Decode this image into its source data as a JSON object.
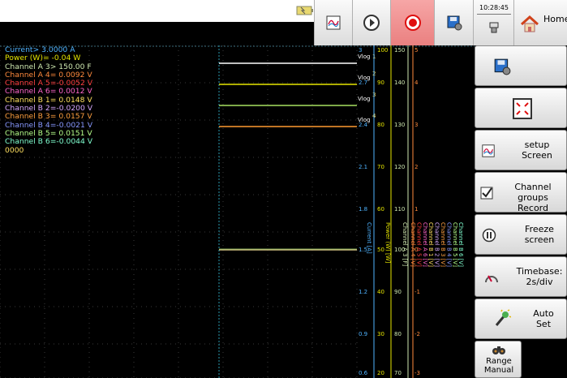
{
  "topbar": {
    "clock": "10:28:45",
    "home_label": "Home"
  },
  "readouts": [
    {
      "text": "Current> 3.0000 A",
      "color": "#4fb3ff"
    },
    {
      "text": "Power (W)= -0.04 W",
      "color": "#e6e600"
    },
    {
      "text": "Channel A 3> 150.00 F",
      "color": "#cfe8b0"
    },
    {
      "text": "Channel A 4= 0.0092 V",
      "color": "#ff8a3d"
    },
    {
      "text": "Channel A 5=-0.0052 V",
      "color": "#ff4040"
    },
    {
      "text": "Channel A 6= 0.0012 V",
      "color": "#ff66cc"
    },
    {
      "text": "Channel B 1= 0.0148 V",
      "color": "#ffe060"
    },
    {
      "text": "Channel B 2=-0.0200 V",
      "color": "#d6a8ff"
    },
    {
      "text": "Channel B 3= 0.0157 V",
      "color": "#ffa040"
    },
    {
      "text": "Channel B 4=-0.0021 V",
      "color": "#8899ff"
    },
    {
      "text": "Channel B 5= 0.0151 V",
      "color": "#b6ff8a"
    },
    {
      "text": "Channel B 6=-0.0044 V",
      "color": "#80ffd0"
    },
    {
      "text": "0000",
      "color": "#ffe060"
    }
  ],
  "vlog_labels": [
    {
      "num": "1",
      "text": "Vlog"
    },
    {
      "num": "2",
      "text": "Vlog"
    },
    {
      "num": "3",
      "text": "Vlog"
    },
    {
      "num": "4",
      "text": "Vlog"
    }
  ],
  "scales": {
    "current": [
      "3",
      "2.7",
      "2.4",
      "2.1",
      "1.8",
      "1.5",
      "1.2",
      "0.9",
      "0.6"
    ],
    "power": [
      "100",
      "90",
      "80",
      "70",
      "60",
      "50",
      "40",
      "30",
      "20"
    ],
    "chA3": [
      "150",
      "140",
      "130",
      "120",
      "110",
      "100",
      "90",
      "80",
      "70"
    ],
    "chA4": [
      "5",
      "4",
      "3",
      "2",
      "1",
      "0",
      "-1",
      "-2",
      "-3"
    ]
  },
  "axis_titles": {
    "current": "Current [A]",
    "power": "Power (W) [W]",
    "channels": [
      {
        "text": "Channel A 3 [F]",
        "color": "#cfe8b0"
      },
      {
        "text": "Channel A 4 [V]",
        "color": "#ff8a3d"
      },
      {
        "text": "Channel A 5 [V]",
        "color": "#ff4040"
      },
      {
        "text": "Channel A 6 [V]",
        "color": "#ff66cc"
      },
      {
        "text": "Channel B 1 [V]",
        "color": "#ffe060"
      },
      {
        "text": "Channel B 2 [V]",
        "color": "#d6a8ff"
      },
      {
        "text": "Channel B 3 [V]",
        "color": "#ffa040"
      },
      {
        "text": "Channel B 4 [V]",
        "color": "#8899ff"
      },
      {
        "text": "Channel B 5 [V]",
        "color": "#b6ff8a"
      },
      {
        "text": "Channel B 6 [V]",
        "color": "#80ffd0"
      }
    ]
  },
  "sidebar": {
    "setup_screen": "setup\nScreen",
    "channel_groups_record": "Channel groups\nRecord",
    "freeze_screen": "Freeze\nscreen",
    "timebase": "Timebase:\n2s/div",
    "auto_set": "Auto\nSet",
    "range_manual": "Range\nManual"
  },
  "colors": {
    "current": "#4fb3ff",
    "power": "#e6e600",
    "vlog": "#ffffff",
    "grid": "#3a3a3a"
  }
}
